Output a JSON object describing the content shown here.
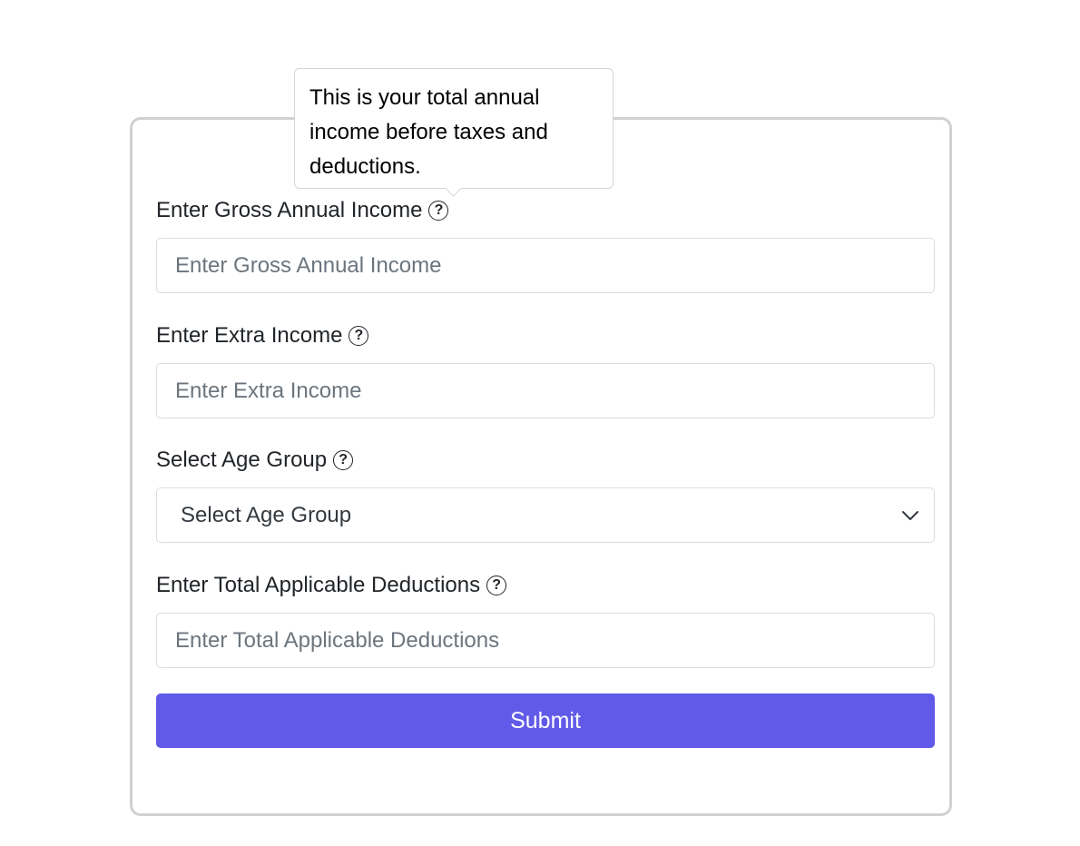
{
  "tooltip": {
    "text": "This is your total annual income before taxes and deductions."
  },
  "form": {
    "gross_income": {
      "label": "Enter Gross Annual Income",
      "placeholder": "Enter Gross Annual Income",
      "value": ""
    },
    "extra_income": {
      "label": "Enter Extra Income",
      "placeholder": "Enter Extra Income",
      "value": ""
    },
    "age_group": {
      "label": "Select Age Group",
      "selected": "Select Age Group"
    },
    "deductions": {
      "label": "Enter Total Applicable Deductions",
      "placeholder": "Enter Total Applicable Deductions",
      "value": ""
    },
    "help_icon_glyph": "?",
    "submit_label": "Submit"
  },
  "colors": {
    "accent": "#615ae8",
    "card_border": "#cfd1d4",
    "input_border": "#d9dcdf",
    "placeholder": "#6c757d"
  },
  "icons": {
    "help": "question-circle-icon",
    "dropdown": "chevron-down-icon"
  }
}
